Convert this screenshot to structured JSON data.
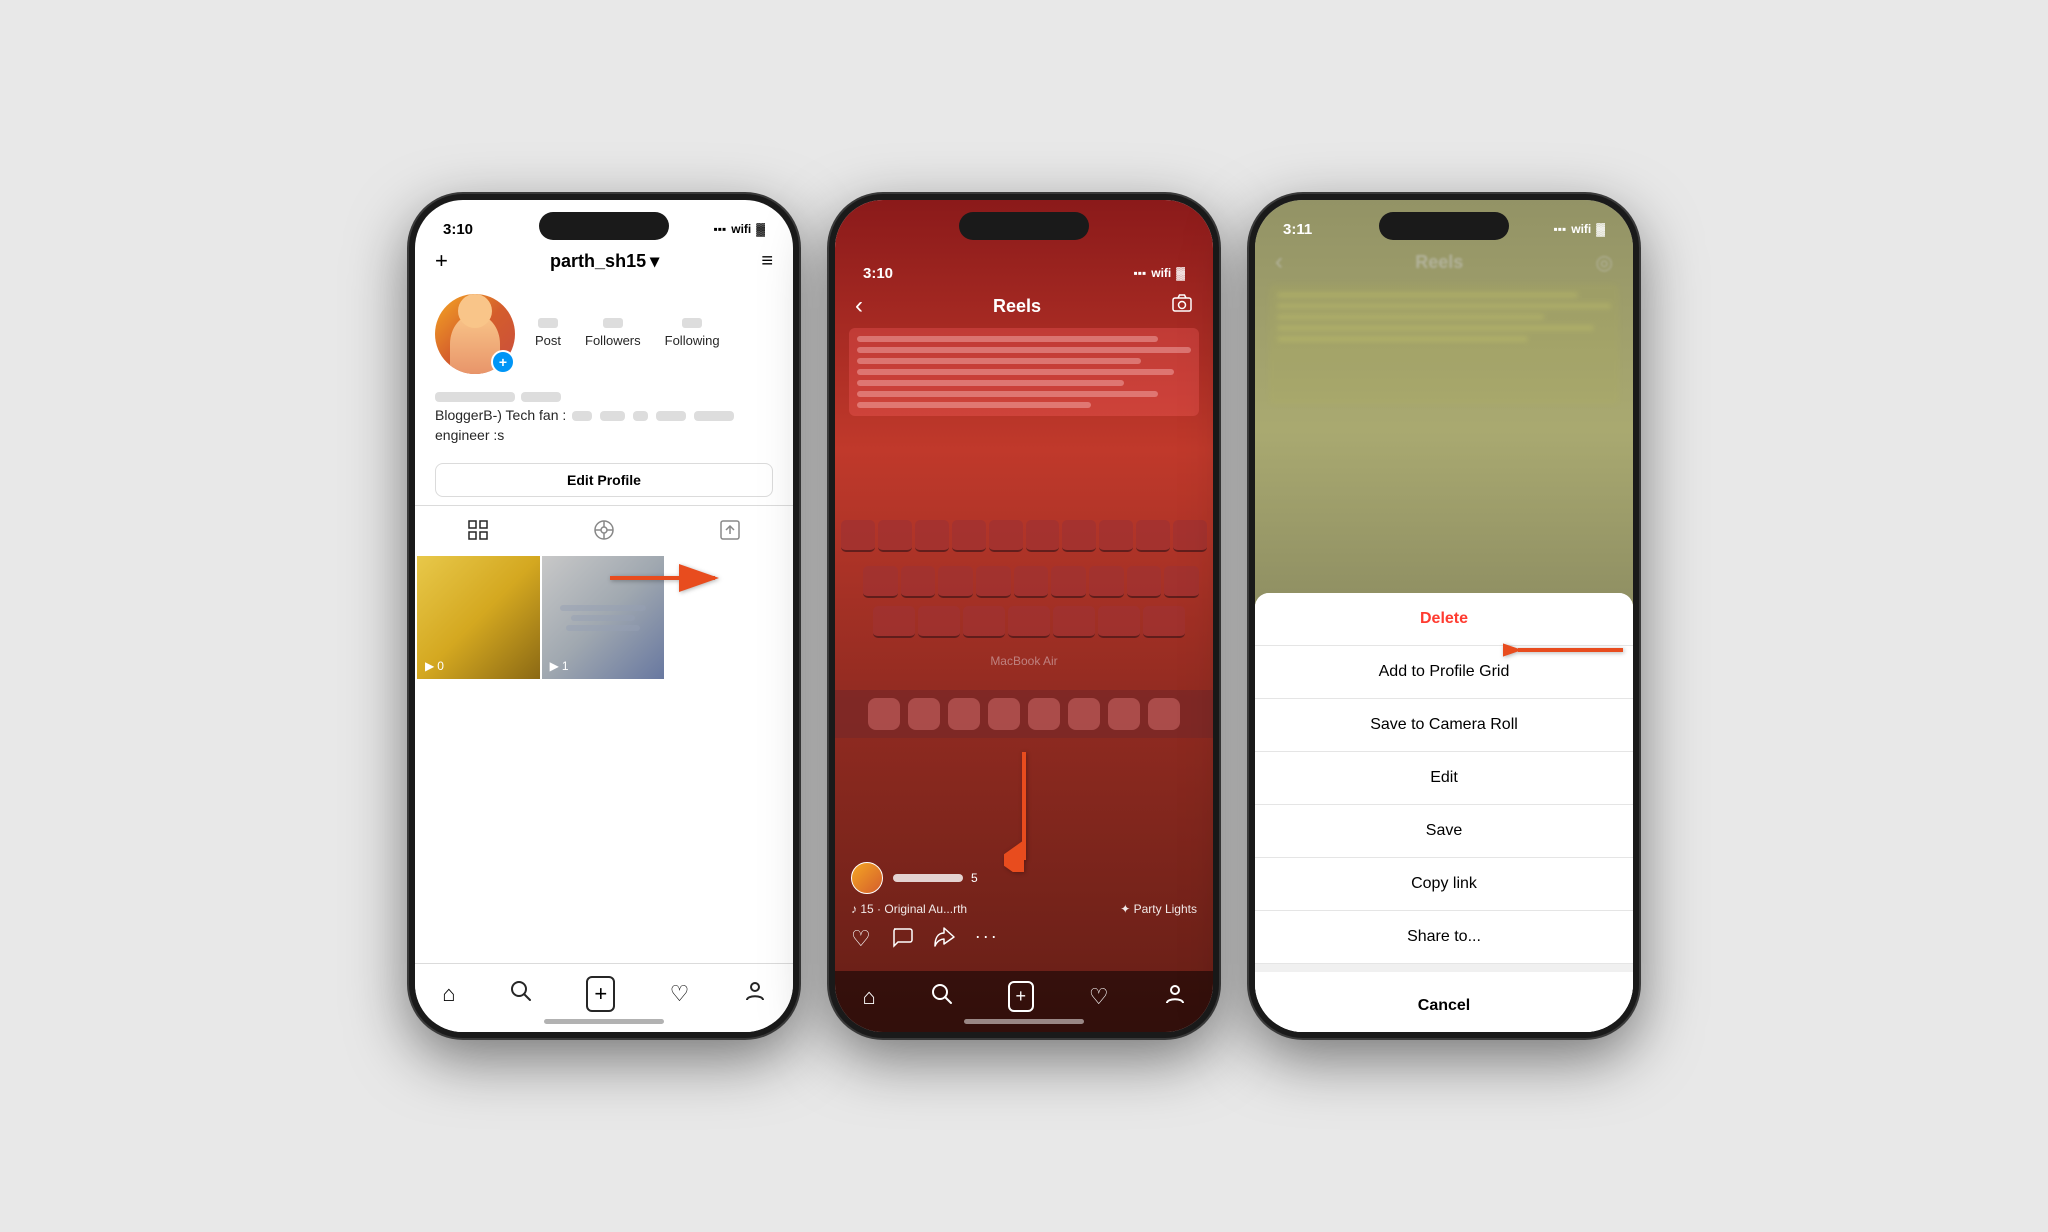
{
  "phone1": {
    "status_time": "3:10",
    "username": "parth_sh15",
    "chevron": "▾",
    "menu_icon": "≡",
    "plus_icon": "+",
    "post_count": "",
    "post_label": "Post",
    "followers_count": "",
    "followers_label": "Followers",
    "following_count": "",
    "following_label": "Following",
    "bio_name_placeholder": "",
    "bio_line1": "BloggerB-) Tech fan :",
    "bio_line2": "engineer :s",
    "edit_profile_label": "Edit Profile",
    "tab_grid_label": "",
    "tab_reels_label": "",
    "tab_tagged_label": "",
    "video1_count": "0",
    "video2_count": "1",
    "nav_home": "⌂",
    "nav_search": "🔍",
    "nav_add": "+",
    "nav_heart": "♡",
    "nav_profile": "👤"
  },
  "phone2": {
    "status_time": "3:10",
    "back_icon": "‹",
    "title": "Reels",
    "camera_icon": "◎",
    "user_count": "5",
    "audio_likes": "15",
    "audio_source": "Original Au...rth",
    "audio_effect": "Party Lights",
    "like_icon": "♡",
    "comment_icon": "💬",
    "share_icon": "➤",
    "more_icon": "•••",
    "nav_home": "⌂",
    "nav_search": "🔍",
    "nav_add": "+",
    "nav_heart": "♡",
    "nav_profile": "👤"
  },
  "phone3": {
    "status_time": "3:11",
    "title": "Reels",
    "menu_items": [
      {
        "label": "Delete",
        "type": "danger"
      },
      {
        "label": "Add to Profile Grid",
        "type": "normal"
      },
      {
        "label": "Save to Camera Roll",
        "type": "normal"
      },
      {
        "label": "Edit",
        "type": "normal"
      },
      {
        "label": "Save",
        "type": "normal"
      },
      {
        "label": "Copy link",
        "type": "normal"
      },
      {
        "label": "Share to...",
        "type": "normal"
      }
    ],
    "cancel_label": "Cancel"
  },
  "arrows": {
    "right_color": "#e84c1e",
    "down_color": "#e84c1e",
    "left_color": "#e84c1e"
  }
}
